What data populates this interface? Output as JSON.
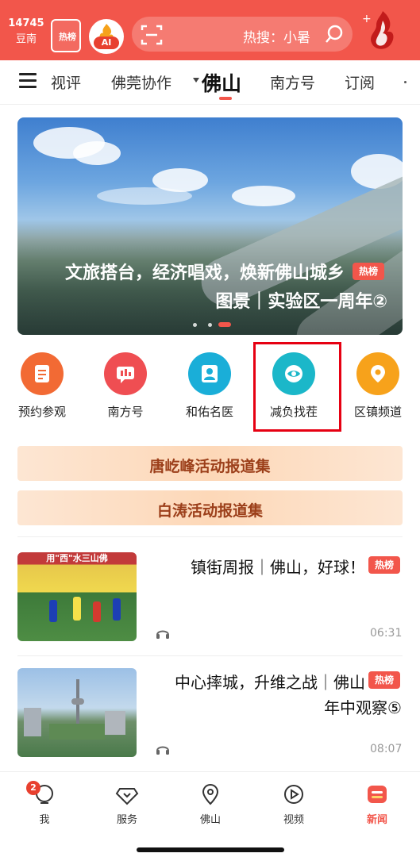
{
  "colors": {
    "brand_red": "#f2564b",
    "highlight_box": "#e60012",
    "collection_text": "#9c3f1a",
    "collection_bg": "#fdd8b8"
  },
  "topbar": {
    "logo_icon": "app-logo-icon",
    "hot_count": "14745",
    "hot_location": "豆南",
    "hot_box_label": "热榜",
    "ai_label": "AI",
    "search_text": "热搜：小暑",
    "search_icon": "search-icon",
    "scan_icon": "scan-icon"
  },
  "tabs": {
    "items": [
      "订阅",
      "南方号",
      "佛山",
      "佛莞协作",
      "视评"
    ],
    "active": "佛山",
    "menu_icon": "menu-icon"
  },
  "banner": {
    "tag": "热榜",
    "title_line1": "文旅搭台，经济唱戏，焕新佛山城乡",
    "title_line2": "图景｜实验区一周年②",
    "page_count": 3,
    "active_page": 1
  },
  "entries": [
    {
      "label": "区镇频道",
      "icon": "location-pin-icon",
      "color": "#f7a21b"
    },
    {
      "label": "减负找茬",
      "icon": "eye-search-icon",
      "color": "#1bb7c9"
    },
    {
      "label": "和佑名医",
      "icon": "doctor-icon",
      "color": "#1aaed8"
    },
    {
      "label": "南方号",
      "icon": "chart-bubble-icon",
      "color": "#ef4e52"
    },
    {
      "label": "预约参观",
      "icon": "document-icon",
      "color": "#f26a34"
    }
  ],
  "collections": [
    {
      "label": "唐屹峰活动报道集"
    },
    {
      "label": "白涛活动报道集"
    }
  ],
  "news": [
    {
      "tag": "热榜",
      "title_line1": "镇街周报｜佛山，好球！",
      "title_line2": "",
      "duration": "06:31",
      "thumb_caption": "用\"西\"水三山佛"
    },
    {
      "tag": "热榜",
      "title_line1": "中心摔城，升维之战｜佛山",
      "title_line2": "年中观察⑤",
      "duration": "08:07",
      "thumb_caption": ""
    }
  ],
  "bottom_nav": {
    "items": [
      {
        "label": "新闻",
        "icon": "news-icon",
        "active": true
      },
      {
        "label": "视频",
        "icon": "video-play-icon",
        "active": false
      },
      {
        "label": "佛山",
        "icon": "location-icon",
        "active": false
      },
      {
        "label": "服务",
        "icon": "service-icon",
        "active": false
      },
      {
        "label": "我",
        "icon": "profile-icon",
        "active": false
      }
    ],
    "badge_count": "2"
  }
}
